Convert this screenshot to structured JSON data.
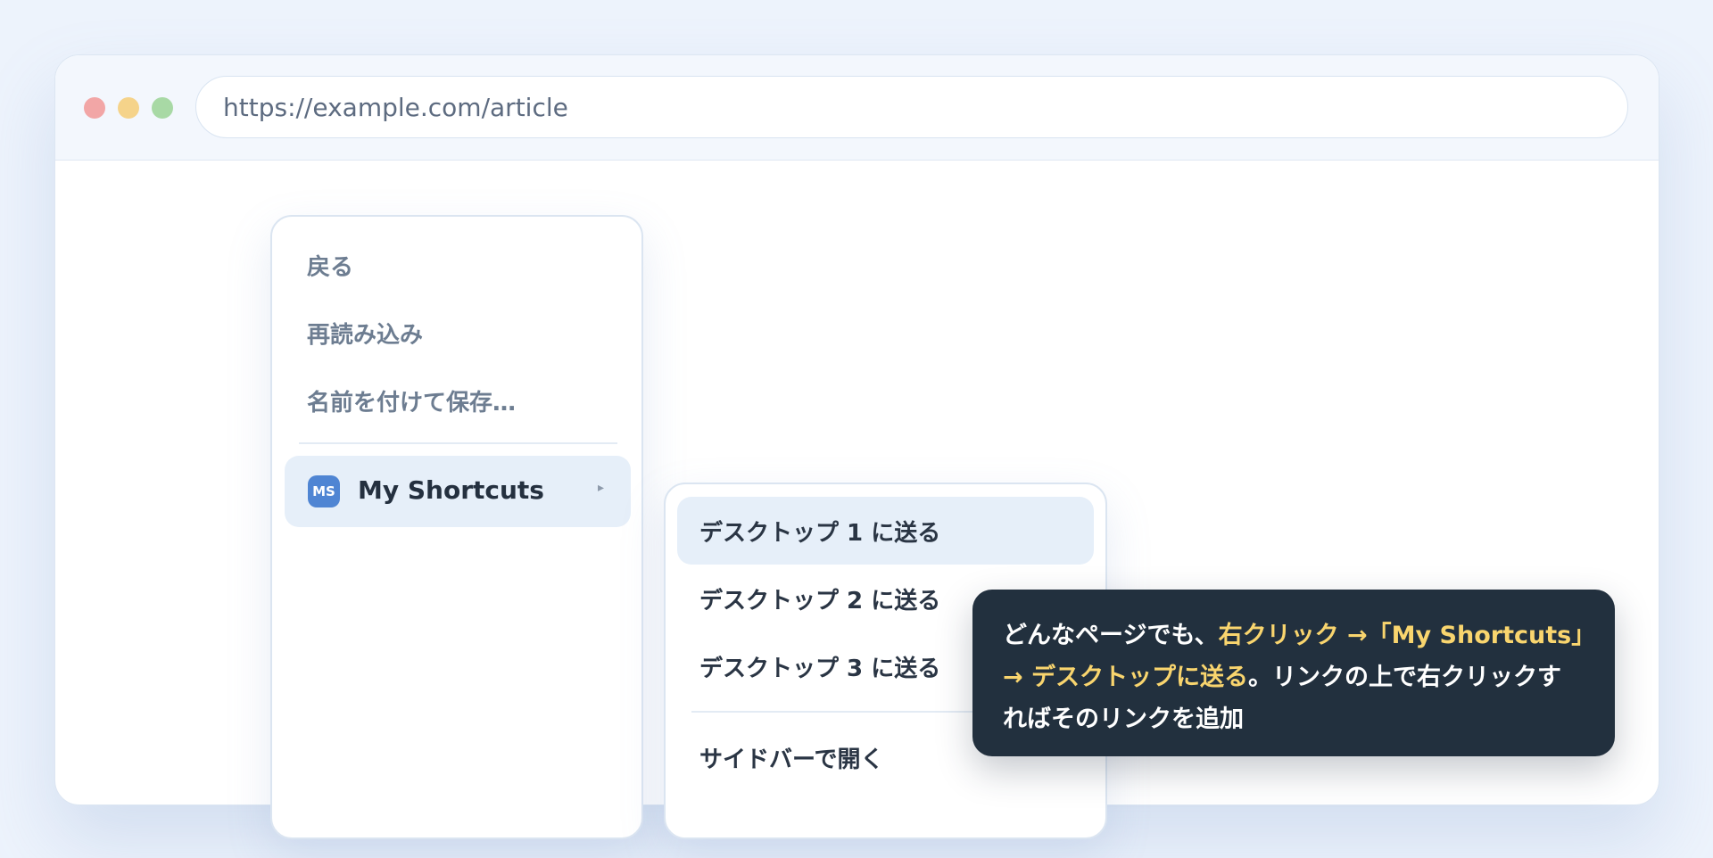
{
  "browser": {
    "url": "https://example.com/article"
  },
  "context_menu": {
    "items": [
      {
        "label": "戻る"
      },
      {
        "label": "再読み込み"
      },
      {
        "label": "名前を付けて保存…"
      }
    ],
    "extension": {
      "logo_text": "MS",
      "label": "My Shortcuts",
      "arrow": "▸"
    }
  },
  "submenu": {
    "items": [
      {
        "label": "デスクトップ 1 に送る"
      },
      {
        "label": "デスクトップ 2 に送る"
      },
      {
        "label": "デスクトップ 3 に送る"
      }
    ],
    "sidebar_label": "サイドバーで開く"
  },
  "tooltip": {
    "part1": "どんなページでも、",
    "highlight": "右クリック →「My Shortcuts」→ デスクトップに送る",
    "part2": "。リンクの上で右クリックすればそのリンクを追加"
  },
  "colors": {
    "accent": "#4f85d3",
    "highlight_bg": "#e6eff9",
    "tooltip_bg": "#22303e",
    "tooltip_highlight": "#f9d56e"
  },
  "icons": {
    "window_controls": [
      "close-dot",
      "minimize-dot",
      "maximize-dot"
    ],
    "submenu_arrow": "chevron-right-icon"
  }
}
